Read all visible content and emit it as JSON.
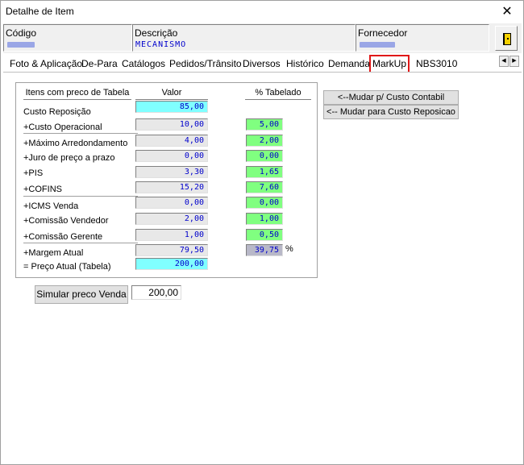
{
  "window": {
    "title": "Detalhe de Item",
    "close_glyph": "✕"
  },
  "header": {
    "codigo_label": "Código",
    "descricao_label": "Descrição",
    "descricao_value": "MECANISMO",
    "fornecedor_label": "Fornecedor"
  },
  "tabs": [
    {
      "label": "Foto & Aplicação"
    },
    {
      "label": "De-Para"
    },
    {
      "label": "Catálogos"
    },
    {
      "label": "Pedidos/Trânsito"
    },
    {
      "label": "Diversos"
    },
    {
      "label": "Histórico"
    },
    {
      "label": "Demanda"
    },
    {
      "label": "MarkUp"
    },
    {
      "label": "NBS3010"
    }
  ],
  "tab_nav": {
    "left": "◀",
    "right": "▶"
  },
  "markup": {
    "col_items": "Itens com preco de Tabela",
    "col_valor": "Valor",
    "col_tabelado": "% Tabelado",
    "rows": [
      {
        "label": "Custo Reposição",
        "valor": "85,00",
        "pct": ""
      },
      {
        "label": "+Custo Operacional",
        "valor": "10,00",
        "pct": "5,00"
      },
      {
        "label": "+Máximo Arredondamento",
        "valor": "4,00",
        "pct": "2,00"
      },
      {
        "label": "+Juro de preço a prazo",
        "valor": "0,00",
        "pct": "0,00"
      },
      {
        "label": "+PIS",
        "valor": "3,30",
        "pct": "1,65"
      },
      {
        "label": "+COFINS",
        "valor": "15,20",
        "pct": "7,60"
      },
      {
        "label": "+ICMS Venda",
        "valor": "0,00",
        "pct": "0,00"
      },
      {
        "label": "+Comissão Vendedor",
        "valor": "2,00",
        "pct": "1,00"
      },
      {
        "label": "+Comissão Gerente",
        "valor": "1,00",
        "pct": "0,50"
      },
      {
        "label": "+Margem Atual",
        "valor": "79,50",
        "pct": "39,75"
      },
      {
        "label": "= Preço Atual (Tabela)",
        "valor": "200,00",
        "pct": ""
      }
    ],
    "percent_sign": "%",
    "btn_custo_contabil": "<--Mudar p/ Custo Contabil",
    "btn_custo_reposicao": "<-- Mudar para Custo Reposicao",
    "btn_simular": "Simular preco Venda",
    "simular_value": "200,00"
  }
}
